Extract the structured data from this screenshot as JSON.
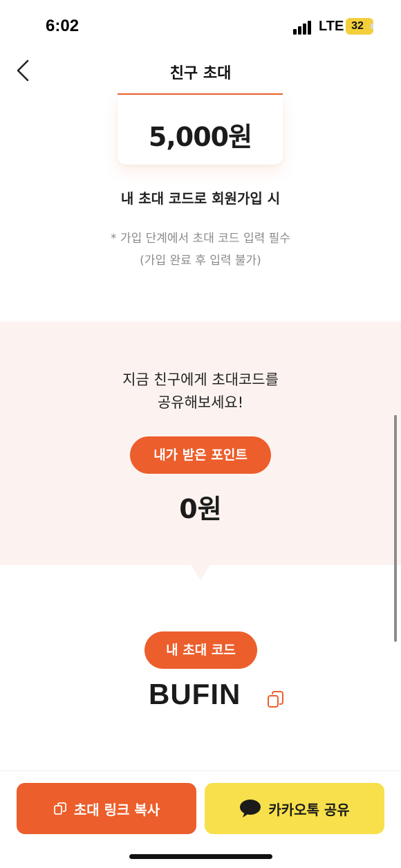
{
  "status_bar": {
    "time": "6:02",
    "network": "LTE",
    "battery": "32"
  },
  "nav": {
    "title": "친구 초대",
    "back_icon": "chevron-left-icon"
  },
  "reward": {
    "amount": "5,000원",
    "description": "내 초대 코드로 회원가입 시",
    "note_line1": "* 가입 단계에서 초대 코드 입력 필수",
    "note_line2": "(가입 완료 후 입력 불가)"
  },
  "share": {
    "line1": "지금 친구에게 초대코드를",
    "line2": "공유해보세요!",
    "points_label": "내가 받은 포인트",
    "points_value": "0원"
  },
  "invite": {
    "code_label": "내 초대 코드",
    "code_value": "BUFIN",
    "copy_icon": "copy-icon"
  },
  "actions": {
    "copy_link_label": "초대 링크 복사",
    "copy_link_icon": "copy-icon",
    "kakao_label": "카카오톡 공유",
    "kakao_icon": "speech-bubble-icon"
  },
  "colors": {
    "accent": "#ec5e2b",
    "share_background": "#fcf3f0",
    "kakao_yellow": "#f7e04b",
    "battery_yellow": "#f3cf3b"
  }
}
